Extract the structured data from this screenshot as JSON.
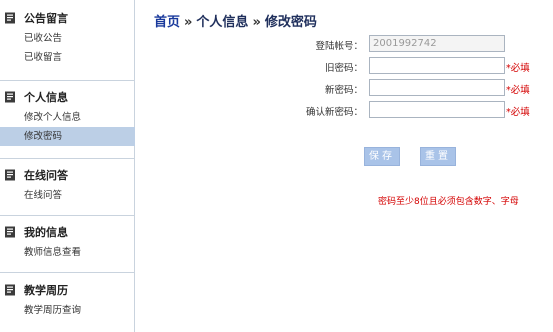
{
  "sidebar": {
    "sections": [
      {
        "title": "公告留言",
        "items": [
          "已收公告",
          "已收留言"
        ]
      },
      {
        "title": "个人信息",
        "items": [
          "修改个人信息",
          "修改密码"
        ]
      },
      {
        "title": "在线问答",
        "items": [
          "在线问答"
        ]
      },
      {
        "title": "我的信息",
        "items": [
          "教师信息查看"
        ]
      },
      {
        "title": "教学周历",
        "items": [
          "教学周历查询"
        ]
      }
    ],
    "active_item": "修改密码"
  },
  "breadcrumb": {
    "home": "首页",
    "separator": "»",
    "level1": "个人信息",
    "level2": "修改密码"
  },
  "form": {
    "account_label": "登陆帐号：",
    "account_value": "2001992742",
    "old_password_label": "旧密码：",
    "new_password_label": "新密码：",
    "confirm_password_label": "确认新密码：",
    "required_mark": "*必填"
  },
  "buttons": {
    "save": "保存",
    "reset": "重置"
  },
  "hint": "密码至少8位且必须包含数字、字母",
  "colors": {
    "accent": "#a9c3e8",
    "active_nav": "#bccfe6",
    "required": "#d40000",
    "breadcrumb_home": "#1a3a9c"
  }
}
